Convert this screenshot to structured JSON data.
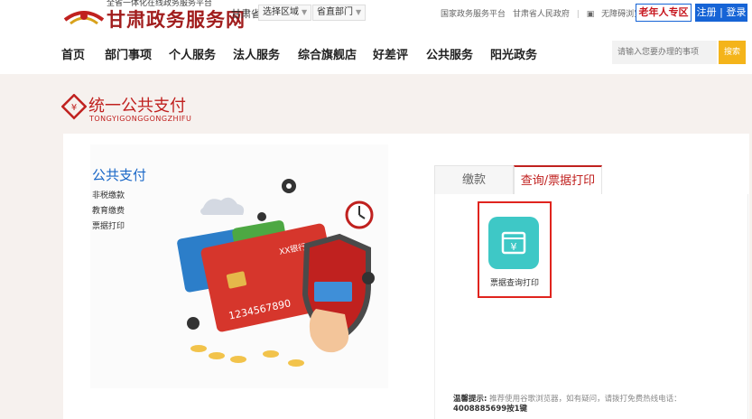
{
  "header": {
    "logo_subtitle": "全省一体化在线政务服务平台",
    "site_title": "甘肃政务服务网",
    "province": "甘肃省",
    "region_select": "选择区域",
    "dept_select": "省直部门",
    "top_links": [
      "国家政务服务平台",
      "甘肃省人民政府",
      "无障碍浏览"
    ],
    "elder_zone": "老年人专区",
    "login": "注册 | 登录"
  },
  "nav": {
    "items": [
      "首页",
      "部门事项",
      "个人服务",
      "法人服务",
      "综合旗舰店",
      "好差评",
      "公共服务",
      "阳光政务"
    ],
    "search_placeholder": "请输入您要办理的事项",
    "search_button": "搜索"
  },
  "section": {
    "title": "统一公共支付",
    "pinyin": "TONGYIGONGGONGZHIFU"
  },
  "left_panel": {
    "title": "公共支付",
    "links": [
      "非税缴款",
      "教育缴费",
      "票据打印"
    ],
    "card_bank_text": "XX银行",
    "card_number": "1234567890"
  },
  "tabs": [
    {
      "label": "缴款"
    },
    {
      "label": "查询/票据打印"
    }
  ],
  "service": {
    "label": "票据查询打印",
    "icon_glyph": "¥"
  },
  "tip": {
    "label": "温馨提示:",
    "text": "推荐使用谷歌浏览器，如有疑问，请拨打免费热线电话：",
    "hotline": "4008885699按1键"
  },
  "colors": {
    "brand_red": "#c0211f",
    "link_blue": "#1664d6",
    "service_teal": "#3ec8c6",
    "search_orange": "#f4b41a"
  }
}
